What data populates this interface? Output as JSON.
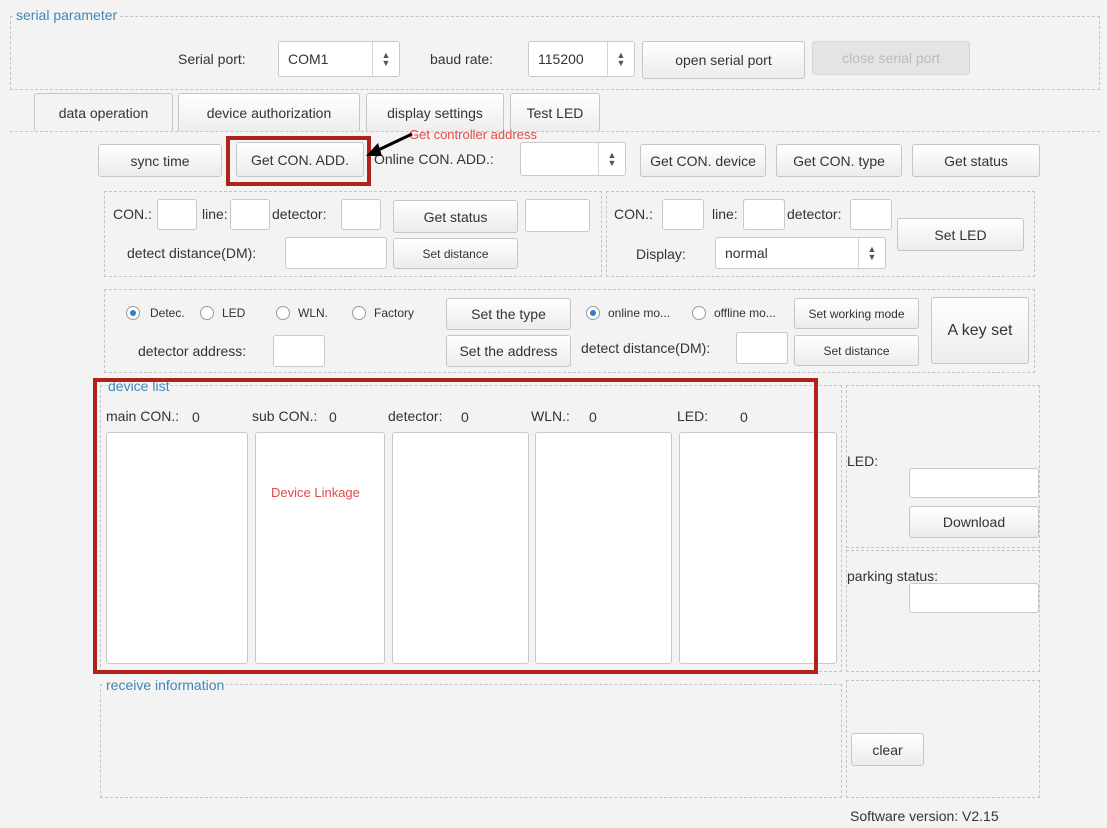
{
  "serial": {
    "legend": "serial parameter",
    "port_label": "Serial port:",
    "port_value": "COM1",
    "baud_label": "baud rate:",
    "baud_value": "115200",
    "open_button": "open serial port",
    "close_button": "close serial port"
  },
  "tabs": [
    "data operation",
    "device authorization",
    "display settings",
    "Test LED"
  ],
  "toolbar": {
    "sync_time": "sync time",
    "get_con_add": "Get CON. ADD.",
    "online_con_add_label": "Online CON. ADD.:",
    "online_con_add_value": "",
    "get_con_device": "Get CON. device",
    "get_con_type": "Get CON. type",
    "get_status": "Get status"
  },
  "detector_box": {
    "con_label": "CON.:",
    "line_label": "line:",
    "detector_label": "detector:",
    "get_status": "Get status",
    "detect_distance_label": "detect distance(DM):",
    "set_distance": "Set distance"
  },
  "led_box": {
    "con_label": "CON.:",
    "line_label": "line:",
    "detector_label": "detector:",
    "set_led": "Set LED",
    "display_label": "Display:",
    "display_value": "normal"
  },
  "type_box": {
    "radio_detec": "Detec.",
    "radio_led": "LED",
    "radio_wln": "WLN.",
    "radio_factory": "Factory",
    "set_type": "Set the type",
    "radio_online": "online mo...",
    "radio_offline": "offline mo...",
    "set_working_mode": "Set working mode",
    "a_key_set": "A key set",
    "detector_address_label": "detector address:",
    "set_address": "Set the address",
    "detect_distance_label": "detect distance(DM):",
    "set_distance": "Set distance"
  },
  "device_list": {
    "legend": "device list",
    "counts": [
      {
        "label": "main CON.:",
        "value": "0"
      },
      {
        "label": "sub CON.:",
        "value": "0"
      },
      {
        "label": "detector:",
        "value": "0"
      },
      {
        "label": "WLN.:",
        "value": "0"
      },
      {
        "label": "LED:",
        "value": "0"
      }
    ]
  },
  "side": {
    "led_label": "LED:",
    "download": "Download",
    "parking_status_label": "parking status:",
    "clear": "clear"
  },
  "receive": {
    "legend": "receive information"
  },
  "footer": {
    "version": "Software version: V2.15"
  },
  "annotations": {
    "get_controller_address": "Get controller address",
    "device_linkage": "Device Linkage",
    "highlight_color": "#b0221c",
    "annotation_color": "#e34a4a"
  }
}
